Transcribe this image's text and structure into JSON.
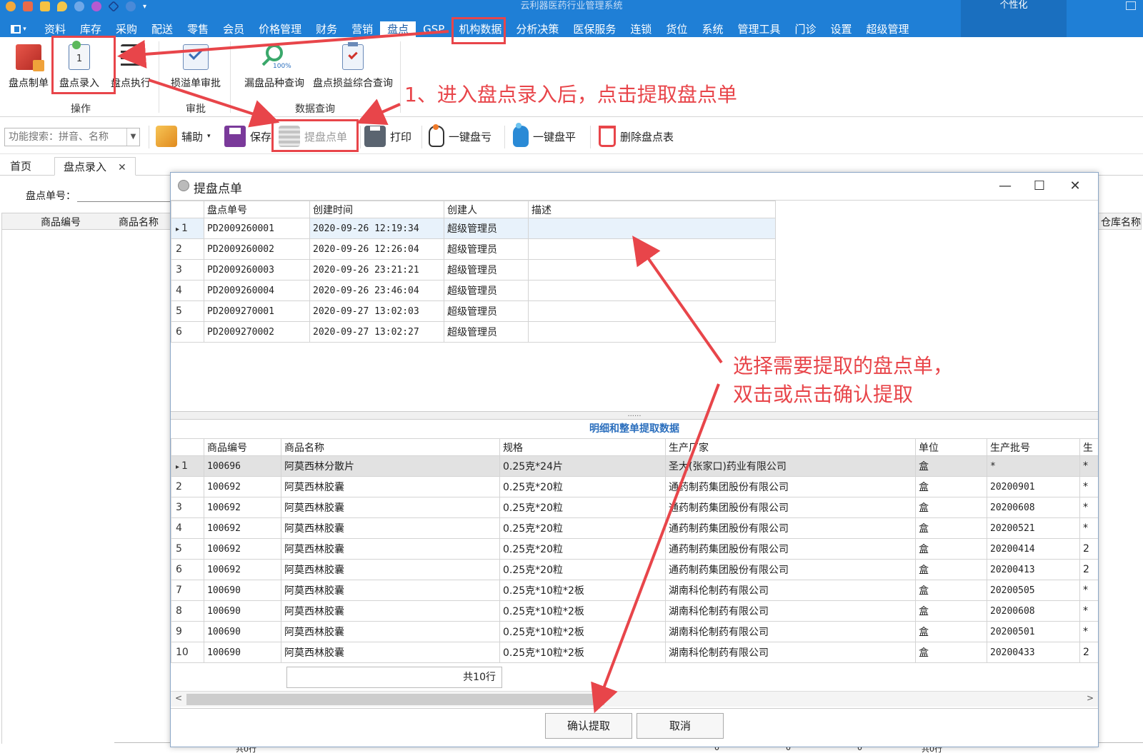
{
  "app": {
    "title": "云利器医药行业管理系统",
    "personalize_label": "个性化"
  },
  "menu": {
    "items": [
      "资料",
      "库存",
      "采购",
      "配送",
      "零售",
      "会员",
      "价格管理",
      "财务",
      "营销",
      "盘点",
      "GSP",
      "机构数据",
      "分析决策",
      "医保服务",
      "连锁",
      "货位",
      "系统",
      "管理工具",
      "门诊",
      "设置",
      "超级管理"
    ],
    "active": "盘点"
  },
  "ribbon": {
    "buttons": [
      "盘点制单",
      "盘点录入",
      "盘点执行",
      "损溢单审批",
      "漏盘品种查询",
      "盘点损益综合查询"
    ],
    "groups": [
      "操作",
      "审批",
      "数据查询"
    ],
    "magnifier_badge": "100%",
    "doc_badge": "1"
  },
  "toolbar": {
    "search_placeholder": "功能搜索：拼音、名称",
    "assist": "辅助",
    "save": "保存",
    "fetch": "提盘点单",
    "print": "打印",
    "one_key_loss": "一键盘亏",
    "one_key_flat": "一键盘平",
    "delete": "删除盘点表"
  },
  "tabs": {
    "home": "首页",
    "entry": "盘点录入"
  },
  "page": {
    "pd_no_label": "盘点单号：",
    "bg_columns": [
      "商品编号",
      "商品名称"
    ],
    "bg_warehouse_column": "仓库名称",
    "footer_rows": "共0行",
    "footer_rows2": "共0行",
    "footer_zeros": [
      "0",
      "0",
      "0"
    ]
  },
  "dialog": {
    "title": "提盘点单",
    "master_columns": [
      "盘点单号",
      "创建时间",
      "创建人",
      "描述"
    ],
    "master_rows": [
      {
        "no": "1",
        "id": "PD2009260001",
        "time": "2020-09-26 12:19:34",
        "creator": "超级管理员",
        "desc": ""
      },
      {
        "no": "2",
        "id": "PD2009260002",
        "time": "2020-09-26 12:26:04",
        "creator": "超级管理员",
        "desc": ""
      },
      {
        "no": "3",
        "id": "PD2009260003",
        "time": "2020-09-26 23:21:21",
        "creator": "超级管理员",
        "desc": ""
      },
      {
        "no": "4",
        "id": "PD2009260004",
        "time": "2020-09-26 23:46:04",
        "creator": "超级管理员",
        "desc": ""
      },
      {
        "no": "5",
        "id": "PD2009270001",
        "time": "2020-09-27 13:02:03",
        "creator": "超级管理员",
        "desc": ""
      },
      {
        "no": "6",
        "id": "PD2009270002",
        "time": "2020-09-27 13:02:27",
        "creator": "超级管理员",
        "desc": ""
      }
    ],
    "splitter_dots": "......",
    "detail_caption": "明细和整单提取数据",
    "detail_columns": [
      "商品编号",
      "商品名称",
      "规格",
      "生产厂家",
      "单位",
      "生产批号",
      "生"
    ],
    "detail_rows": [
      {
        "no": "1",
        "code": "100696",
        "name": "阿莫西林分散片",
        "spec": "0.25克*24片",
        "maker": "圣大(张家口)药业有限公司",
        "unit": "盒",
        "batch": "*",
        "extra": "*"
      },
      {
        "no": "2",
        "code": "100692",
        "name": "阿莫西林胶囊",
        "spec": "0.25克*20粒",
        "maker": "通药制药集团股份有限公司",
        "unit": "盒",
        "batch": "20200901",
        "extra": "*"
      },
      {
        "no": "3",
        "code": "100692",
        "name": "阿莫西林胶囊",
        "spec": "0.25克*20粒",
        "maker": "通药制药集团股份有限公司",
        "unit": "盒",
        "batch": "20200608",
        "extra": "*"
      },
      {
        "no": "4",
        "code": "100692",
        "name": "阿莫西林胶囊",
        "spec": "0.25克*20粒",
        "maker": "通药制药集团股份有限公司",
        "unit": "盒",
        "batch": "20200521",
        "extra": "*"
      },
      {
        "no": "5",
        "code": "100692",
        "name": "阿莫西林胶囊",
        "spec": "0.25克*20粒",
        "maker": "通药制药集团股份有限公司",
        "unit": "盒",
        "batch": "20200414",
        "extra": "2"
      },
      {
        "no": "6",
        "code": "100692",
        "name": "阿莫西林胶囊",
        "spec": "0.25克*20粒",
        "maker": "通药制药集团股份有限公司",
        "unit": "盒",
        "batch": "20200413",
        "extra": "2"
      },
      {
        "no": "7",
        "code": "100690",
        "name": "阿莫西林胶囊",
        "spec": "0.25克*10粒*2板",
        "maker": "湖南科伦制药有限公司",
        "unit": "盒",
        "batch": "20200505",
        "extra": "*"
      },
      {
        "no": "8",
        "code": "100690",
        "name": "阿莫西林胶囊",
        "spec": "0.25克*10粒*2板",
        "maker": "湖南科伦制药有限公司",
        "unit": "盒",
        "batch": "20200608",
        "extra": "*"
      },
      {
        "no": "9",
        "code": "100690",
        "name": "阿莫西林胶囊",
        "spec": "0.25克*10粒*2板",
        "maker": "湖南科伦制药有限公司",
        "unit": "盒",
        "batch": "20200501",
        "extra": "*"
      },
      {
        "no": "10",
        "code": "100690",
        "name": "阿莫西林胶囊",
        "spec": "0.25克*10粒*2板",
        "maker": "湖南科伦制药有限公司",
        "unit": "盒",
        "batch": "20200433",
        "extra": "2"
      }
    ],
    "total_rows": "共10行",
    "confirm": "确认提取",
    "cancel": "取消"
  },
  "annotations": {
    "step1": "1、进入盘点录入后，点击提取盘点单",
    "step2_line1": "选择需要提取的盘点单，",
    "step2_line2": "双击或点击确认提取",
    "color": "#e8454a"
  },
  "colors": {
    "titlebar": "#1f7fd6",
    "personalize": "#1a6fbf",
    "caption": "#2a6ebd",
    "highlight": "#e8454a"
  }
}
